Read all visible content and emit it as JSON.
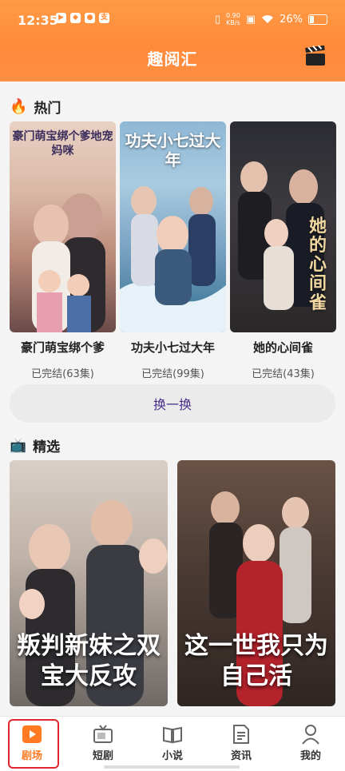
{
  "status_bar": {
    "time": "12:35",
    "net_speed_value": "0.90",
    "net_speed_unit": "KB/s",
    "battery": "26%"
  },
  "header": {
    "title": "趣阅汇"
  },
  "hot_section": {
    "title": "热门",
    "items": [
      {
        "title": "豪门萌宝绑个爹",
        "status": "已完结(63集)",
        "poster_text": "豪门萌宝绑个爹地宠妈咪"
      },
      {
        "title": "功夫小七过大年",
        "status": "已完结(99集)",
        "poster_text": "功夫小七过大年"
      },
      {
        "title": "她的心间雀",
        "status": "已完结(43集)",
        "poster_text": "她的心间雀"
      }
    ],
    "refresh_label": "换一换"
  },
  "featured_section": {
    "title": "精选",
    "items": [
      {
        "poster_text": "叛判新妹之双宝大反攻"
      },
      {
        "poster_text": "这一世我只为自己活"
      }
    ]
  },
  "tabbar": {
    "items": [
      {
        "label": "剧场",
        "active": true
      },
      {
        "label": "短剧"
      },
      {
        "label": "小说"
      },
      {
        "label": "资讯"
      },
      {
        "label": "我的"
      }
    ]
  },
  "colors": {
    "accent": "#ff8a3a",
    "active_tab": "#ff7a22",
    "highlight_frame": "#e1262d"
  }
}
